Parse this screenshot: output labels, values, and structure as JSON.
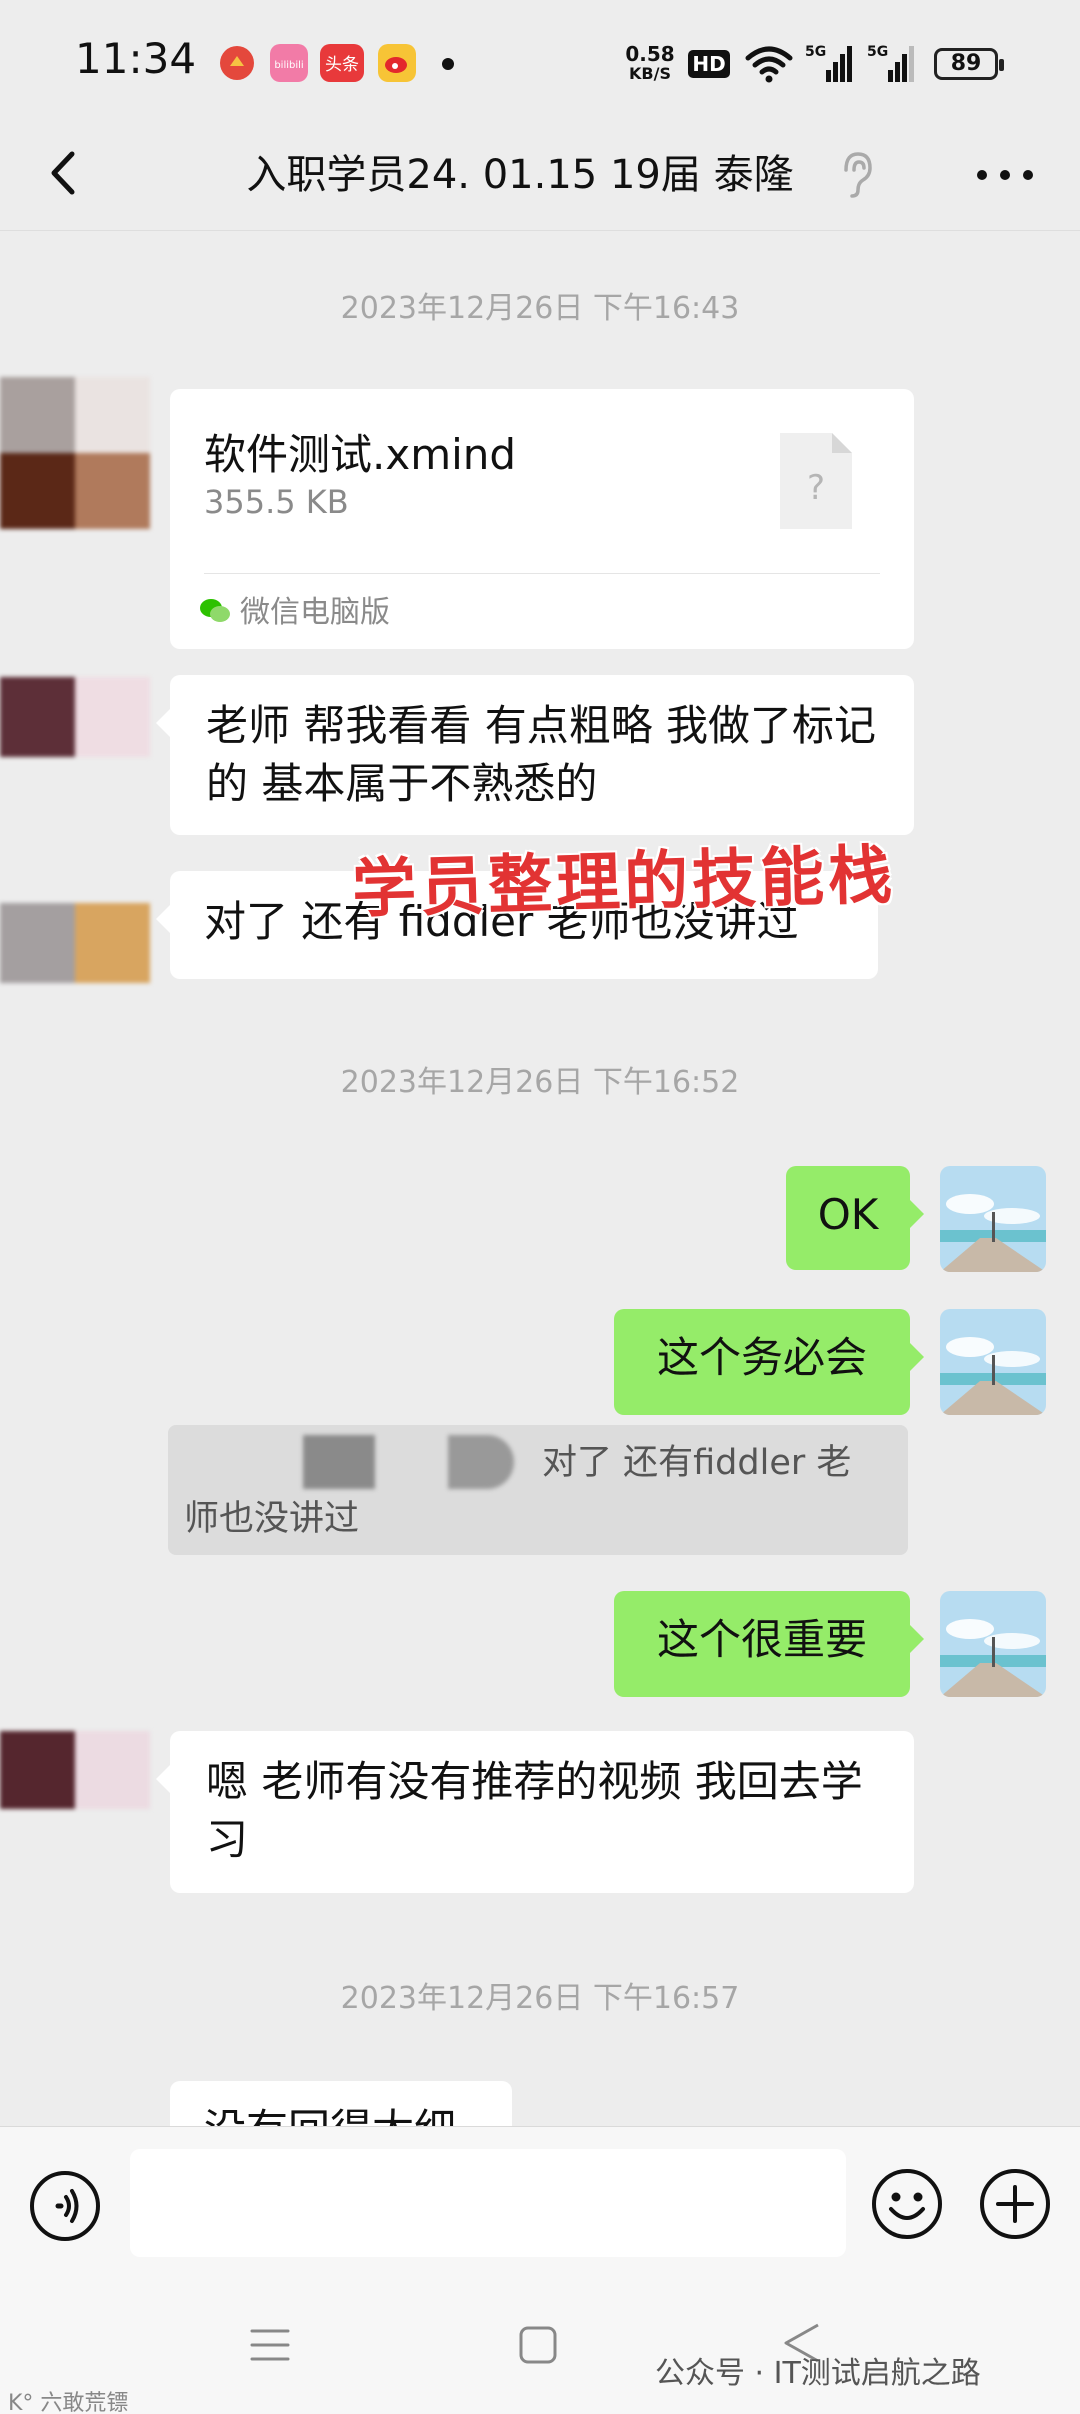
{
  "status_bar": {
    "time": "11:34",
    "net_speed_value": "0.58",
    "net_speed_unit": "KB/S",
    "hd_badge": "HD",
    "signal_1_label": "5G",
    "signal_2_label": "5G",
    "battery_level": "89",
    "app_icons": [
      "app-red-icon",
      "bilibili-icon",
      "toutiao-icon",
      "weibo-icon"
    ],
    "app_icon_texts": [
      "bilibili",
      "头条"
    ]
  },
  "header": {
    "title": "入职学员24. 01.15 19届  泰隆"
  },
  "messages": {
    "time_1": "2023年12月26日 下午16:43",
    "file": {
      "name": "软件测试.xmind",
      "size": "355.5 KB",
      "source": "微信电脑版",
      "icon_glyph": "?"
    },
    "overlay_caption": "学员整理的技能栈",
    "msg_1": "老师 帮我看看  有点粗略  我做了标记的 基本属于不熟悉的",
    "msg_2": "对了 还有 fiddler   老师也没讲过",
    "time_2": "2023年12月26日 下午16:52",
    "reply_1": "OK",
    "reply_2": "这个务必会",
    "quote_line_1": "对了 还有fiddler   老",
    "quote_line_2": "师也没讲过",
    "reply_3": "这个很重要",
    "msg_3": "嗯  老师有没有推荐的视频 我回去学习",
    "time_3": "2023年12月26日 下午16:57",
    "msg_4_partial": "没有回得太细"
  },
  "watermarks": {
    "right": "公众号 · IT测试启航之路",
    "left": "K° 六敢荒镖"
  },
  "colors": {
    "background": "#ededed",
    "bubble_outgoing": "#95ec69",
    "bubble_incoming": "#ffffff",
    "caption": "#e23333",
    "timestamp": "#a6a6a6"
  }
}
